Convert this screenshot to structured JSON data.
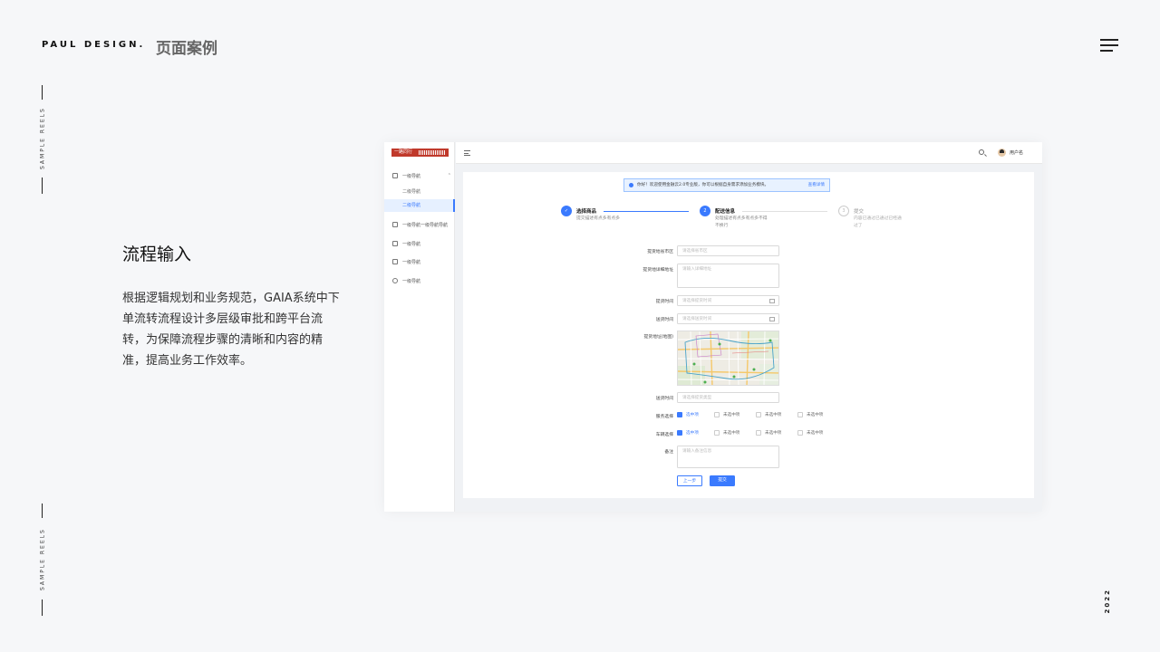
{
  "header": {
    "brand": "PAUL DESIGN.",
    "category": "页面案例"
  },
  "side_label": "SAMPLE REELS",
  "year": "2022",
  "section": {
    "title": "流程输入",
    "description": "根据逻辑规划和业务规范，GAIA系统中下单流转流程设计多层级审批和跨平台流转，为保障流程步骤的清晰和内容的精准，提高业务工作效率。"
  },
  "mock": {
    "logo": "一路同行",
    "nav": [
      {
        "label": "一级导航",
        "icon": "home-icon"
      },
      {
        "label": "一级导航一级导航导航",
        "icon": "edit-icon"
      },
      {
        "label": "一级导航",
        "icon": "calendar-icon"
      },
      {
        "label": "一级导航",
        "icon": "list-icon"
      },
      {
        "label": "一级导航",
        "icon": "check-circle-icon"
      }
    ],
    "subnav": [
      "二级导航",
      "二级导航"
    ],
    "username": "用户名",
    "notice": {
      "text": "你好！欢迎使用金融云2.0专业版，你可以根据自身需求添加业务模块。",
      "link": "查看详情"
    },
    "steps": [
      {
        "title": "选择商品",
        "desc": "提交描述有点多有点多",
        "status": "done"
      },
      {
        "title": "配送信息",
        "desc": "处理描述有点多有点多不得不换行",
        "num": "2",
        "status": "active"
      },
      {
        "title": "提交",
        "desc": "内容已通过已通过已经通过了",
        "num": "3",
        "status": "wait"
      }
    ],
    "form": {
      "province_label": "提货地省市区",
      "province_ph": "请选择省市区",
      "address_label": "提货地详细地址",
      "address_ph": "请输入详细地址",
      "pickup_time_label": "提货时间",
      "pickup_time_ph": "请选择提货时间",
      "delivery_time_label": "送货时间",
      "delivery_time_ph": "请选择送货时间",
      "map_label": "提货地址(地图)",
      "delivery_time2_label": "送货时间",
      "delivery_time2_ph": "请选择提货类型",
      "service_label": "服务选择",
      "vehicle_label": "车辆选择",
      "options": [
        "选中项",
        "未选中项",
        "未选中项",
        "未选中项"
      ],
      "remark_label": "备注",
      "remark_ph": "请输入备注信息"
    },
    "buttons": {
      "prev": "上一步",
      "submit": "提交"
    },
    "colors": {
      "primary": "#3a7afe",
      "logo": "#c0392b"
    }
  }
}
